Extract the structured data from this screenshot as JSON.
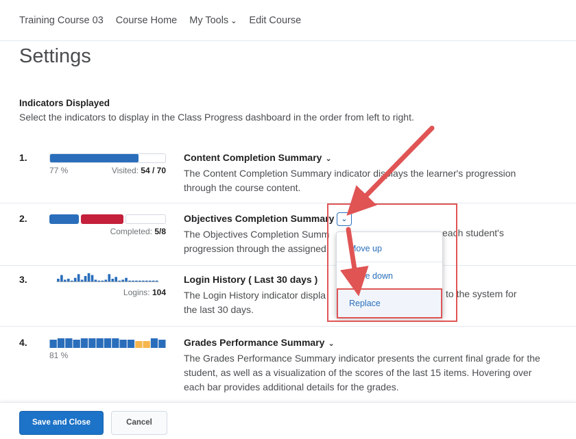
{
  "nav": {
    "course": "Training Course 03",
    "home": "Course Home",
    "tools": "My Tools",
    "edit": "Edit Course"
  },
  "page_title": "Settings",
  "indicators_heading": "Indicators Displayed",
  "indicators_desc": "Select the indicators to display in the Class Progress dashboard in the order from left to right.",
  "indicators": [
    {
      "num": "1.",
      "title": "Content Completion Summary",
      "desc": "The Content Completion Summary indicator displays the learner's progression through the course content.",
      "percent": "77 %",
      "visited_label": "Visited:",
      "visited_value": "54 / 70",
      "progress": 0.77
    },
    {
      "num": "2.",
      "title": "Objectives Completion Summary",
      "desc": "The Objectives Completion Summ",
      "desc2": "progression through the assigned",
      "desc_tail": "each student's",
      "completed_label": "Completed:",
      "completed_value": "5/8"
    },
    {
      "num": "3.",
      "title": "Login History ( Last 30 days )",
      "desc": "The Login History indicator displa",
      "desc_tail": "to the system for",
      "desc2": "the last 30 days.",
      "logins_label": "Logins:",
      "logins_value": "104",
      "bars": [
        3,
        7,
        2,
        3,
        1,
        4,
        8,
        2,
        6,
        9,
        7,
        2,
        1,
        1,
        2,
        8,
        3,
        5,
        1,
        2,
        4,
        1,
        1,
        1,
        1,
        1,
        1,
        1,
        1,
        1
      ]
    },
    {
      "num": "4.",
      "title": "Grades Performance Summary",
      "desc": "The Grades Performance Summary indicator presents the current final grade for the student, as well as a visualization of the scores of the last 15 items. Hovering over each bar provides additional details for the grades.",
      "percent": "81 %"
    }
  ],
  "menu": {
    "move_up": "Move up",
    "move_down": "Move down",
    "replace": "Replace"
  },
  "buttons": {
    "save": "Save and Close",
    "cancel": "Cancel"
  },
  "colors": {
    "blue": "#2a6ebb",
    "red": "#c4203b",
    "orange": "#f6b64d",
    "annotation": "#e05454"
  },
  "icons": {
    "dropdown": "chevron-down-icon"
  }
}
